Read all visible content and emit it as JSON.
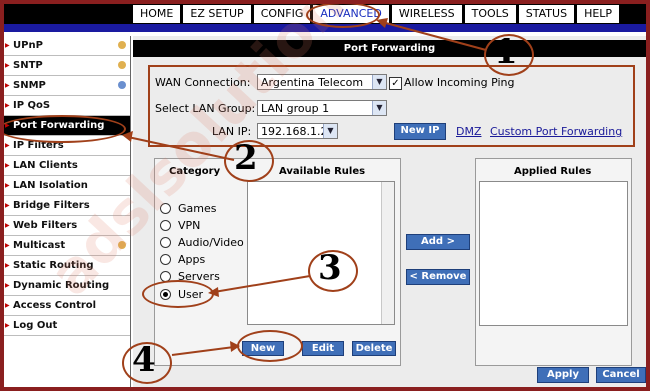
{
  "nav": {
    "tabs": [
      "HOME",
      "EZ SETUP",
      "CONFIG",
      "ADVANCED",
      "WIRELESS",
      "TOOLS",
      "STATUS",
      "HELP"
    ],
    "active": "ADVANCED"
  },
  "sidebar": {
    "items": [
      "UPnP",
      "SNTP",
      "SNMP",
      "IP QoS",
      "Port Forwarding",
      "IP Filters",
      "LAN Clients",
      "LAN Isolation",
      "Bridge Filters",
      "Web Filters",
      "Multicast",
      "Static Routing",
      "Dynamic Routing",
      "Access Control",
      "Log Out"
    ],
    "active": "Port Forwarding"
  },
  "page": {
    "title": "Port Forwarding"
  },
  "form": {
    "wan_label": "WAN Connection:",
    "wan_value": "Argentina Telecom",
    "allow_ping_label": "Allow Incoming Ping",
    "allow_ping_checked": true,
    "lan_group_label": "Select LAN Group:",
    "lan_group_value": "LAN group 1",
    "lan_ip_label": "LAN IP:",
    "lan_ip_value": "192.168.1.2",
    "new_ip_label": "New IP",
    "dmz_label": "DMZ",
    "custom_label": "Custom Port Forwarding"
  },
  "rules": {
    "category_header": "Category",
    "available_header": "Available Rules",
    "applied_header": "Applied Rules",
    "categories": [
      "Games",
      "VPN",
      "Audio/Video",
      "Apps",
      "Servers",
      "User"
    ],
    "selected_category": "User",
    "add_label": "Add >",
    "remove_label": "< Remove",
    "new_label": "New",
    "edit_label": "Edit",
    "delete_label": "Delete"
  },
  "footer": {
    "apply_label": "Apply",
    "cancel_label": "Cancel"
  },
  "annotations": {
    "markers": [
      "1",
      "2",
      "3",
      "4"
    ],
    "watermark": "adslsolution"
  },
  "colors": {
    "border": "#8a1f1f",
    "nav_bar": "#000000",
    "accent_bar": "#1a1aa0",
    "button": "#3f6fb8",
    "annotation": "#a0401a"
  }
}
